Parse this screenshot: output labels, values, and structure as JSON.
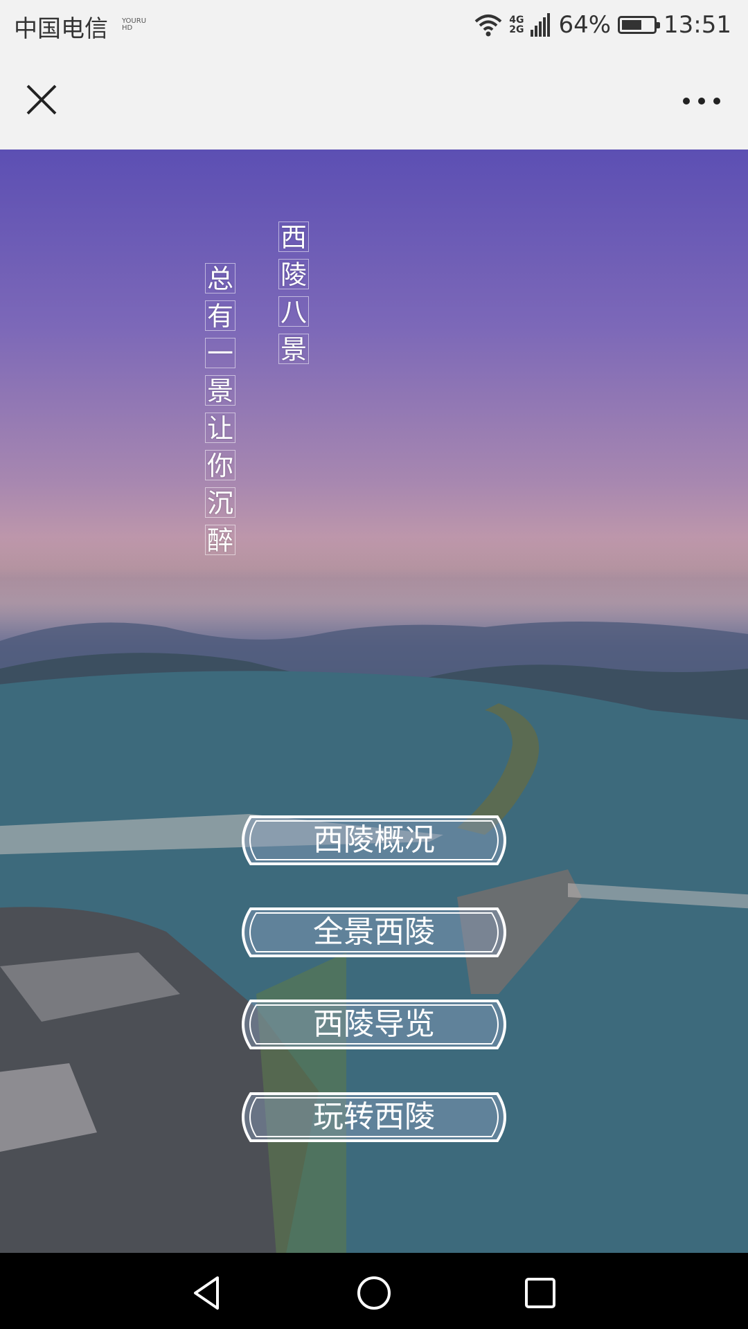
{
  "status_bar": {
    "carrier": "中国电信",
    "hd_badge_line1": "YOURU",
    "hd_badge_line2": "HD",
    "network_line1": "4G",
    "network_line2": "2G",
    "battery_percent": "64%",
    "battery_level": 0.64,
    "time": "13:51",
    "icons": [
      "wifi-icon",
      "signal-icon",
      "battery-icon"
    ]
  },
  "title_bar": {
    "close_icon": "close-icon",
    "more_icon": "more-icon"
  },
  "hero": {
    "title_chars": [
      "西",
      "陵",
      "八",
      "景"
    ],
    "subtitle_chars": [
      "总",
      "有",
      "一",
      "景",
      "让",
      "你",
      "沉",
      "醉"
    ]
  },
  "menu": [
    {
      "label": "西陵概况"
    },
    {
      "label": "全景西陵"
    },
    {
      "label": "西陵导览"
    },
    {
      "label": "玩转西陵"
    }
  ],
  "nav_bar": {
    "icons": [
      "back-icon",
      "home-icon",
      "recents-icon"
    ]
  },
  "colors": {
    "sky_top": "#5c4fb3",
    "water": "#3a6272",
    "menu_border": "#ffffff",
    "nav_background": "#000000"
  }
}
